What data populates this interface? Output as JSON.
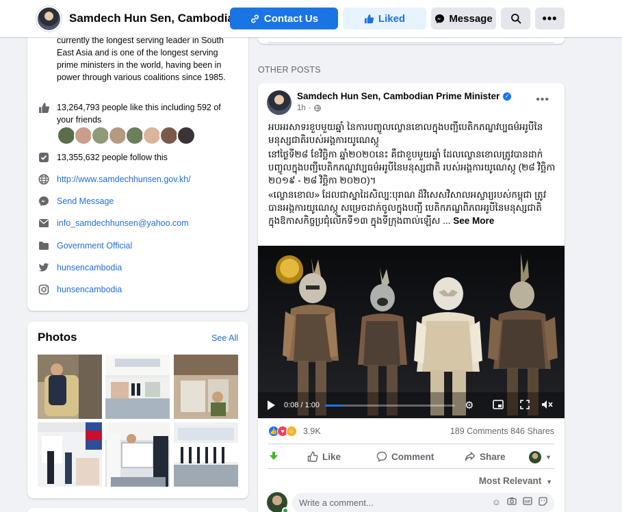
{
  "header": {
    "page_name": "Samdech Hun Sen, Cambodian…",
    "contact_label": "Contact Us",
    "liked_label": "Liked",
    "message_label": "Message"
  },
  "about": {
    "bio": "currently the longest serving leader in South East Asia and is one of the longest serving prime ministers in the world, having been in power through various coalitions since 1985.",
    "likes": "13,264,793 people like this including 592 of your friends",
    "follows": "13,355,632 people follow this",
    "website": "http://www.samdechhunsen.gov.kh/",
    "send_message": "Send Message",
    "email": "info_samdechhunsen@yahoo.com",
    "category": "Government Official",
    "twitter": "hunsencambodia",
    "instagram": "hunsencambodia"
  },
  "photos": {
    "title": "Photos",
    "see_all": "See All"
  },
  "other_posts_label": "OTHER POSTS",
  "post": {
    "author": "Samdech Hun Sen, Cambodian Prime Minister",
    "time": "1h",
    "text_p1": "អបអរសាទរខួបមួយឆ្នាំ នៃការបញ្ចូលល្ខោនខោលក្នុងបញ្ជីបេតិកភណ្ឌវប្បធម៌អរូបីនៃមនុស្សជាតិរបស់អង្គការយូណេស្កូ",
    "text_p2": "នៅថ្ងៃទី២៨ ខែវិច្ឆិកា ឆ្នាំ២០២០នេះ គឺជាខួបមួយឆ្នាំ ដែលល្ខោនខោលត្រូវបានដាក់បញ្ចូលក្នុងបញ្ជីបេតិកភណ្ឌវប្បធម៌អរូបីនៃមនុស្សជាតិ របស់អង្គការយូណេស្កូ (២៨ វិច្ឆិកា ២០១៩ - ២៨ វិច្ឆិកា ២០២០)។",
    "text_p3": "«ល្ខោនខោល» ដែលជាស្នាដៃសិល្បៈបុរាណ ដ៏វិសេសវិសាលអស្ចារ្យរបស់កម្ពុជា ត្រូវបានអង្គការយូណេស្កូ សម្រេចដាក់ចូលក្នុងបញ្ជី បេតិកភណ្ឌពិភពអរូបីនៃមនុស្សជាតិ ក្នុងឱកាសកិច្ចប្រជុំលើកទី១៣ ក្នុងទីក្រុងពាល់ឡើស ...",
    "see_more": "See More",
    "video_time": "0:08 / 1:00",
    "video_progress": 0.13,
    "reaction_count": "3.9K",
    "stats": "189 Comments  846 Shares",
    "like_label": "Like",
    "comment_label": "Comment",
    "share_label": "Share",
    "sort_label": "Most Relevant",
    "comment_placeholder": "Write a comment..."
  }
}
